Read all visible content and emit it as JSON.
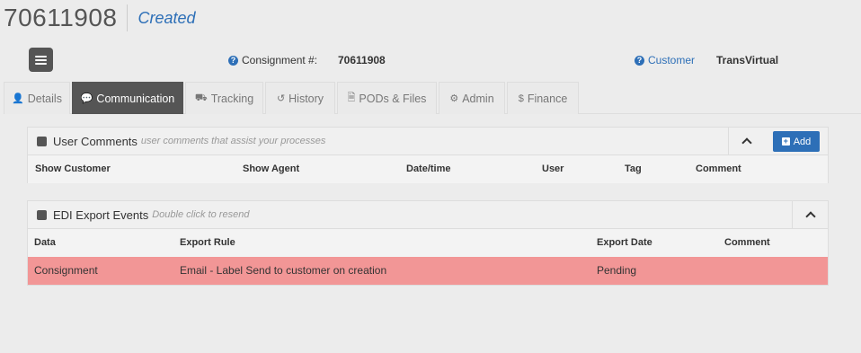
{
  "header": {
    "consignment_number": "70611908",
    "status": "Created"
  },
  "info": {
    "consignment_label": "Consignment #:",
    "consignment_value": "70611908",
    "customer_label": "Customer",
    "customer_value": "TransVirtual"
  },
  "tabs": [
    {
      "label": "Details",
      "icon": "user-icon"
    },
    {
      "label": "Communication",
      "icon": "comment-icon"
    },
    {
      "label": "Tracking",
      "icon": "truck-icon"
    },
    {
      "label": "History",
      "icon": "history-icon"
    },
    {
      "label": "PODs & Files",
      "icon": "file-icon"
    },
    {
      "label": "Admin",
      "icon": "gear-icon"
    },
    {
      "label": "Finance",
      "icon": "dollar-icon"
    }
  ],
  "user_comments": {
    "title": "User Comments",
    "subtitle": "user comments that assist your processes",
    "add_label": "Add",
    "columns": [
      "Show Customer",
      "Show Agent",
      "Date/time",
      "User",
      "Tag",
      "Comment"
    ]
  },
  "edi_events": {
    "title": "EDI Export Events",
    "subtitle": "Double click to resend",
    "columns": [
      "Data",
      "Export Rule",
      "Export Date",
      "Comment"
    ],
    "rows": [
      {
        "data": "Consignment",
        "export_rule": "Email - Label Send to customer on creation",
        "export_date": "Pending",
        "comment": ""
      }
    ],
    "row_color": "#f29696"
  },
  "colors": {
    "accent": "#2d6fb7",
    "active_tab": "#555555"
  }
}
